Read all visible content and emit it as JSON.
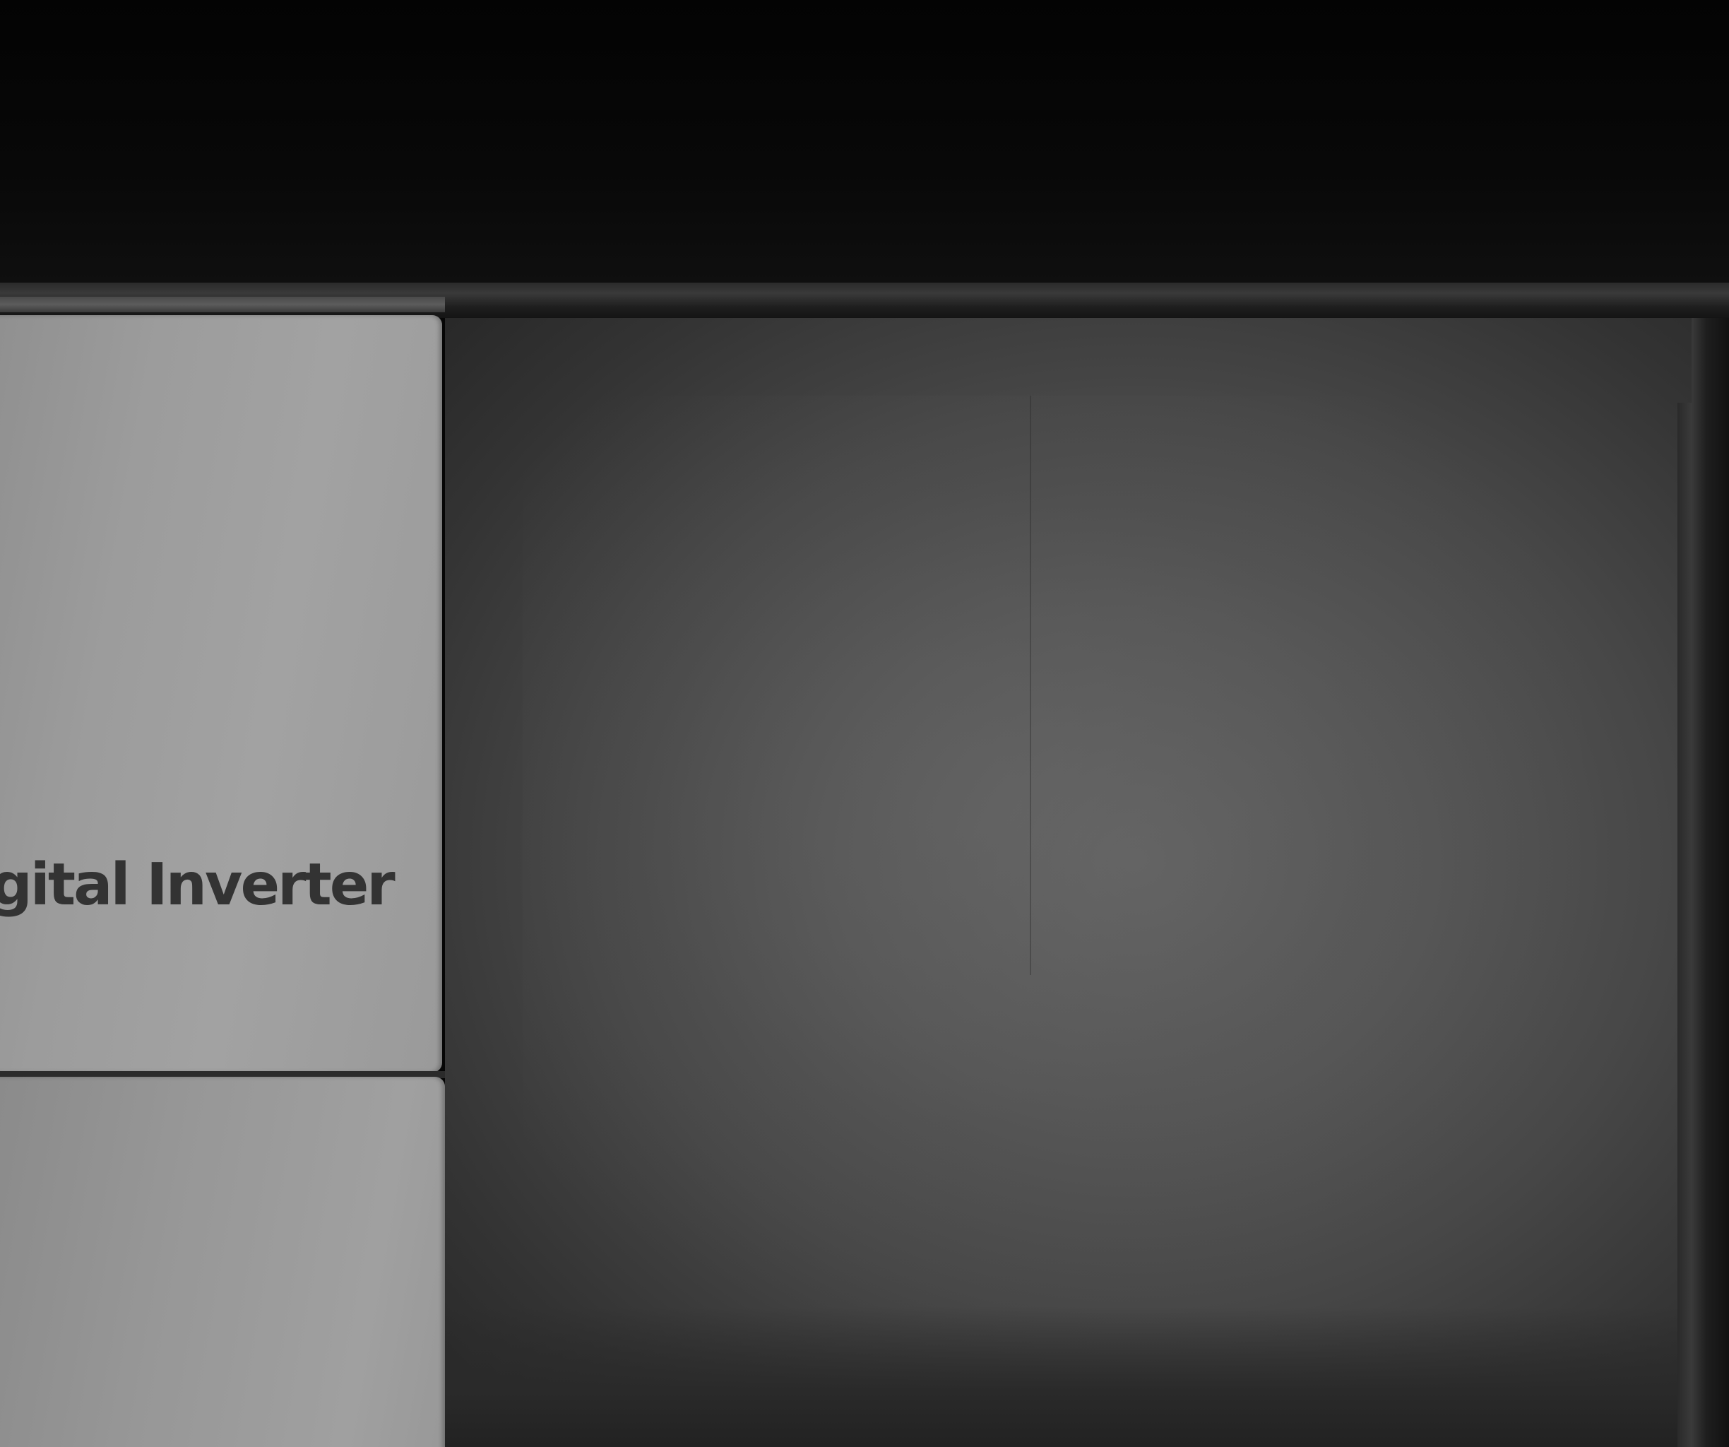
{
  "scene": {
    "description_text": "",
    "door_label": "igital Inverter",
    "colors": {
      "door_panel": "#9c9c9c",
      "label_text": "#333333",
      "cavity": "#565656",
      "background": "#060606"
    }
  }
}
